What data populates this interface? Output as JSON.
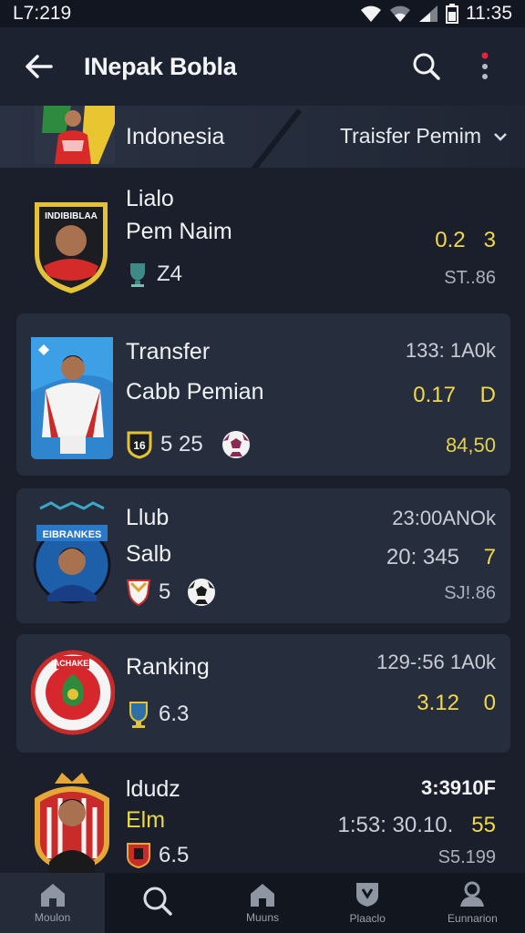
{
  "status_bar": {
    "left_time": "L7:219",
    "right_time": "11:35"
  },
  "app_bar": {
    "title": "INepak Bobla"
  },
  "filter": {
    "country": "Indonesia",
    "sort_label": "Traisfer Pemim"
  },
  "cards": [
    {
      "line1": "Lialo",
      "line2": "Pem Naim",
      "stat": "Z4",
      "right_top": "",
      "right_mid_a": "0.2",
      "right_mid_b": "3",
      "right_bot": "ST..86",
      "badge_text": "INDIBIBLAA"
    },
    {
      "line1": "Transfer",
      "line2": "Cabb Pemian",
      "stat": "5 25",
      "chip": "16",
      "right_top": "133: 1A0k",
      "right_mid_a": "0.17",
      "right_mid_b": "D",
      "right_bot": "84,50"
    },
    {
      "line1": "Llub",
      "line2": "Salb",
      "stat": "5",
      "right_top": "23:00ANOk",
      "right_mid_a": "20: 345",
      "right_mid_b": "7",
      "right_bot": "SJ!.86",
      "badge_text": "EIBRANKES"
    },
    {
      "line1": "Ranking",
      "line2": "",
      "stat": "6.3",
      "right_top": "129-:56 1A0k",
      "right_mid_a": "3.12",
      "right_mid_b": "0",
      "right_bot": "",
      "badge_text": "IACHAKER"
    },
    {
      "line1": "ldudz",
      "line2": "Elm",
      "stat": "6.5",
      "right_top": "3:3910F",
      "right_mid_a": "1:53: 30.10.",
      "right_mid_b": "55",
      "right_bot": "S5.199"
    }
  ],
  "bottom_nav": [
    {
      "label": "Moulon",
      "icon": "home-icon"
    },
    {
      "label": "",
      "icon": "search-icon"
    },
    {
      "label": "Muuns",
      "icon": "home-icon"
    },
    {
      "label": "Plaaclo",
      "icon": "shield-icon"
    },
    {
      "label": "Eunnarion",
      "icon": "user-icon"
    }
  ],
  "colors": {
    "background": "#1a1f2b",
    "card": "#262d3c",
    "accent_yellow": "#e9d94a",
    "red_dot": "#e5243b"
  }
}
